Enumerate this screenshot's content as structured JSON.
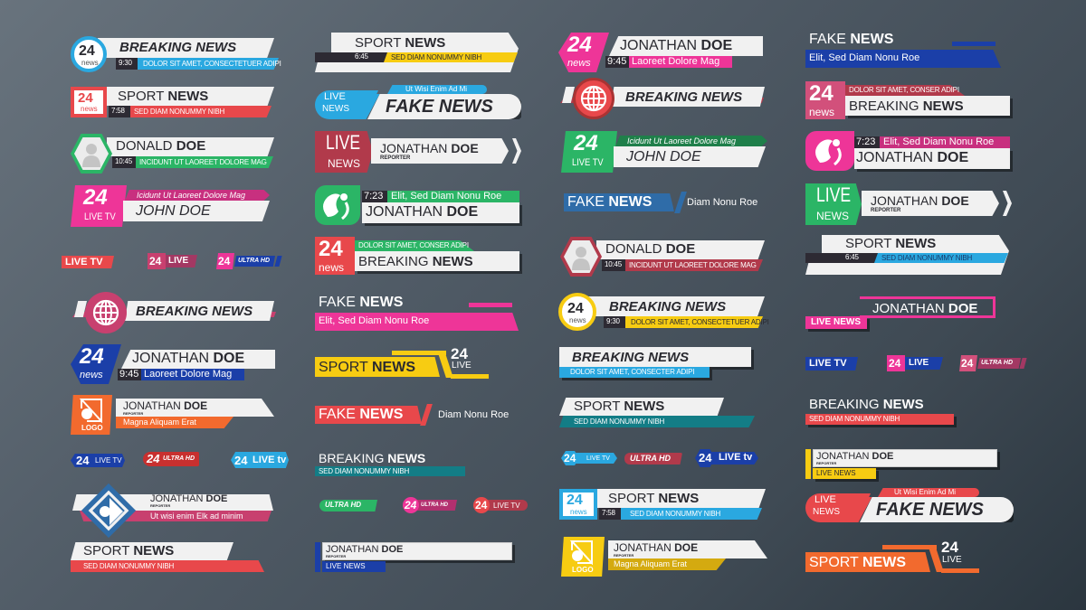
{
  "colors": {
    "blue": "#2aa8e0",
    "red": "#e8484b",
    "green": "#2bb566",
    "pink": "#ee3598",
    "magenta": "#c8307f",
    "navy": "#1b3fa8",
    "orange": "#f26a2e",
    "yellow": "#f7cc12",
    "teal": "#137d86",
    "maroon": "#b13a4b",
    "dark": "#2d2a33",
    "white_bar": "#f1f1f1"
  },
  "col1": {
    "b1": {
      "badge_num": "24",
      "badge_sub": "news",
      "title": "BREAKING NEWS",
      "time": "9:30",
      "sub": "DOLOR SIT AMET, CONSECTETUER ADIPI"
    },
    "b2": {
      "badge_num": "24",
      "badge_sub": "news",
      "title_light": "SPORT ",
      "title_bold": "NEWS",
      "time": "7:58",
      "sub": "SED DIAM NONUMMY NIBH"
    },
    "b3": {
      "avatar": "person-icon",
      "title_light": "DONALD ",
      "title_bold": "DOE",
      "time": "10:45",
      "sub": "INCIDUNT UT LAOREET DOLORE MAG"
    },
    "b4": {
      "badge_num": "24",
      "badge_sub": "LIVE TV",
      "sub": "Icidunt Ut Laoreet Dolore Mag",
      "title": "JOHN DOE"
    },
    "tags": {
      "t1": "LIVE TV",
      "t2_num": "24",
      "t2": "LIVE",
      "t3_num": "24",
      "t3": "ULTRA HD"
    },
    "b5": {
      "title": "BREAKING NEWS"
    },
    "b6": {
      "badge_num": "24",
      "badge_sub": "news",
      "title_light": "JONATHAN ",
      "title_bold": "DOE",
      "time": "9:45",
      "sub": "Laoreet Dolore Mag"
    },
    "b7": {
      "logo": "LOGO",
      "title_light": "JONATHAN ",
      "title_bold": "DOE",
      "role": "REPORTER",
      "sub": "Magna Aliquam Erat"
    },
    "tags2": {
      "t1_num": "24",
      "t1": "LIVE TV",
      "t2_num": "24",
      "t2": "ULTRA HD",
      "t3_num": "24",
      "t3": "LIVE tv"
    },
    "b8": {
      "title_light": "JONATHAN ",
      "title_bold": "DOE",
      "role": "REPORTER",
      "sub": "Ut wisi enim Elk ad minim"
    },
    "b9": {
      "title_light": "SPORT ",
      "title_bold": "NEWS",
      "sub": "SED DIAM NONUMMY NIBH"
    }
  },
  "col2": {
    "b1": {
      "title_light": "SPORT ",
      "title_bold": "NEWS",
      "time": "6:45",
      "sub": "SED DIAM NONUMMY NIBH"
    },
    "b2": {
      "badge_top": "LIVE",
      "badge_bot": "NEWS",
      "sub": "Ut Wisi Enim Ad Mi",
      "title": "FAKE NEWS"
    },
    "b3": {
      "badge_top": "LIVE",
      "badge_bot": "NEWS",
      "title_light": "JONATHAN ",
      "title_bold": "DOE",
      "role": "REPORTER"
    },
    "b4": {
      "time": "7:23",
      "sub": "Elit, Sed Diam Nonu Roe",
      "title_light": "JONATHAN ",
      "title_bold": "DOE"
    },
    "b5": {
      "badge_num": "24",
      "badge_sub": "news",
      "sub": "DOLOR SIT AMET, CONSER ADIPI",
      "title_light": "BREAKING ",
      "title_bold": "NEWS"
    },
    "b6": {
      "title_light": "FAKE ",
      "title_bold": "NEWS",
      "sub": "Elit, Sed Diam Nonu Roe"
    },
    "b7": {
      "title_light": "SPORT ",
      "title_bold": "NEWS",
      "num": "24",
      "live": "LIVE"
    },
    "b8": {
      "title_light": "FAKE ",
      "title_bold": "NEWS",
      "aside": "Diam Nonu Roe"
    },
    "b9": {
      "title_light": "BREAKING ",
      "title_bold": "NEWS",
      "sub": "SED DIAM NONUMMY NIBH"
    },
    "tags": {
      "t1": "ULTRA HD",
      "t2_num": "24",
      "t2": "ULTRA HD",
      "t3_num": "24",
      "t3": "LIVE TV"
    },
    "b10": {
      "title_light": "JONATHAN ",
      "title_bold": "DOE",
      "role": "REPORTER",
      "sub": "LIVE NEWS"
    }
  },
  "col3": {
    "b1": {
      "badge_num": "24",
      "badge_sub": "news",
      "title_light": "JONATHAN ",
      "title_bold": "DOE",
      "time": "9:45",
      "sub": "Laoreet Dolore Mag"
    },
    "b2": {
      "title": "BREAKING NEWS"
    },
    "b3": {
      "badge_num": "24",
      "badge_sub": "LIVE TV",
      "sub": "Icidunt Ut Laoreet Dolore Mag",
      "title": "JOHN DOE"
    },
    "b4": {
      "title_light": "FAKE ",
      "title_bold": "NEWS",
      "aside": "Diam Nonu Roe"
    },
    "b5": {
      "title_light": "DONALD ",
      "title_bold": "DOE",
      "time": "10:45",
      "sub": "INCIDUNT UT LAOREET DOLORE MAG"
    },
    "b6": {
      "badge_num": "24",
      "badge_sub": "news",
      "title": "BREAKING NEWS",
      "time": "9:30",
      "sub": "DOLOR SIT AMET, CONSECTETUER ADIPI"
    },
    "b7": {
      "title": "BREAKING NEWS",
      "sub": "DOLOR SIT AMET, CONSECTER ADIPI"
    },
    "b8": {
      "title_light": "SPORT ",
      "title_bold": "NEWS",
      "sub": "SED DIAM NONUMMY NIBH"
    },
    "tags": {
      "t1_num": "24",
      "t1": "LIVE TV",
      "t2": "ULTRA HD",
      "t3_num": "24",
      "t3": "LIVE tv"
    },
    "b9": {
      "badge_num": "24",
      "badge_sub": "news",
      "title_light": "SPORT ",
      "title_bold": "NEWS",
      "time": "7:58",
      "sub": "SED DIAM NONUMMY NIBH"
    },
    "b10": {
      "logo": "LOGO",
      "title_light": "JONATHAN ",
      "title_bold": "DOE",
      "role": "REPORTER",
      "sub": "Magna Aliquam Erat"
    }
  },
  "col4": {
    "b1": {
      "title_light": "FAKE ",
      "title_bold": "NEWS",
      "sub": "Elit, Sed Diam Nonu Roe"
    },
    "b2": {
      "badge_num": "24",
      "badge_sub": "news",
      "sub": "DOLOR SIT AMET, CONSER ADIPI",
      "title_light": "BREAKING ",
      "title_bold": "NEWS"
    },
    "b3": {
      "time": "7:23",
      "sub": "Elit, Sed Diam Nonu Roe",
      "title_light": "JONATHAN ",
      "title_bold": "DOE"
    },
    "b4": {
      "badge_top": "LIVE",
      "badge_bot": "NEWS",
      "title_light": "JONATHAN ",
      "title_bold": "DOE",
      "role": "REPORTER"
    },
    "b5": {
      "title_light": "SPORT ",
      "title_bold": "NEWS",
      "time": "6:45",
      "sub": "SED DIAM NONUMMY NIBH"
    },
    "b6": {
      "title_light": "JONATHAN ",
      "title_bold": "DOE",
      "sub": "LIVE NEWS"
    },
    "tags": {
      "t1": "LIVE TV",
      "t2_num": "24",
      "t2": "LIVE",
      "t3_num": "24",
      "t3": "ULTRA HD"
    },
    "b7": {
      "title_light": "BREAKING ",
      "title_bold": "NEWS",
      "sub": "SED DIAM NONUMMY NIBH"
    },
    "b8": {
      "title_light": "JONATHAN ",
      "title_bold": "DOE",
      "role": "REPORTER",
      "sub": "LIVE NEWS"
    },
    "b9": {
      "badge_top": "LIVE",
      "badge_bot": "NEWS",
      "sub": "Ut Wisi Enim Ad Mi",
      "title": "FAKE NEWS"
    },
    "b10": {
      "title_light": "SPORT ",
      "title_bold": "NEWS",
      "num": "24",
      "live": "LIVE"
    }
  }
}
